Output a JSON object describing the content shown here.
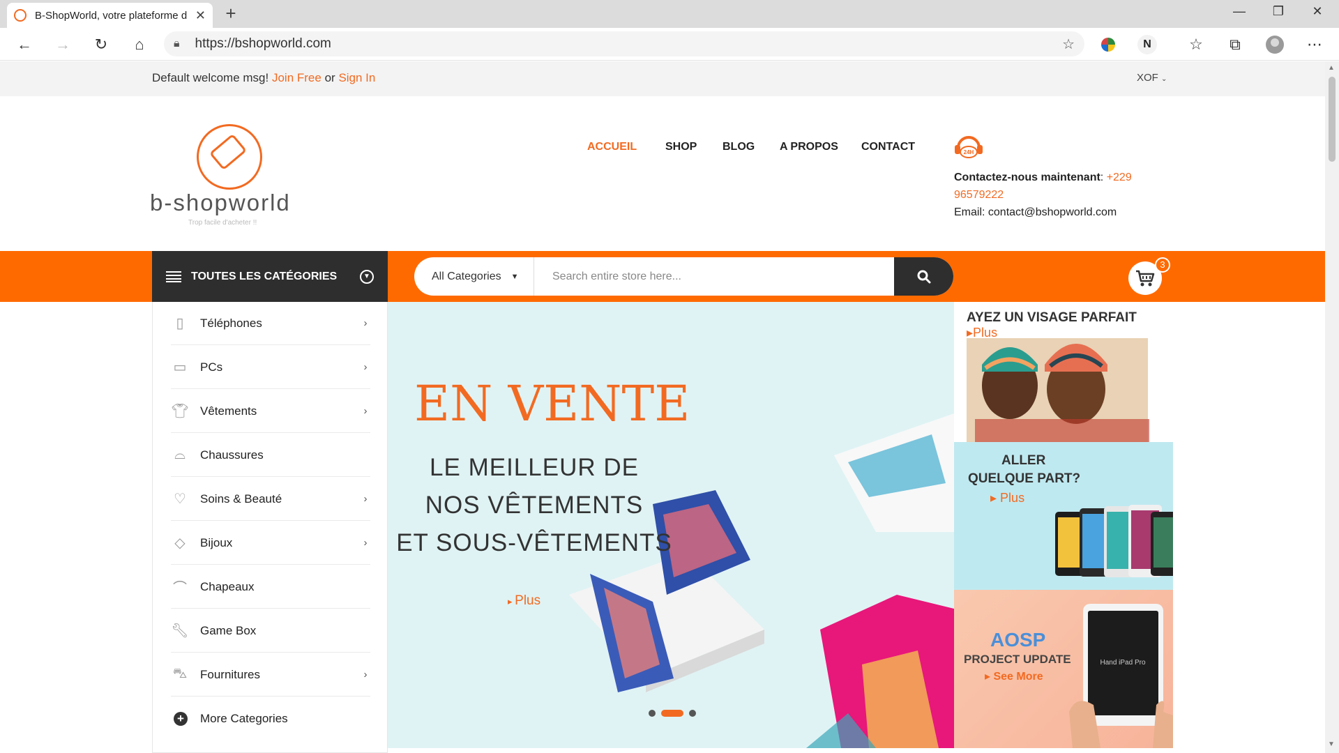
{
  "browser": {
    "tab_title": "B-ShopWorld, votre plateforme d",
    "url": "https://bshopworld.com"
  },
  "topbar": {
    "welcome": "Default welcome msg!",
    "join": "Join Free",
    "or": "or",
    "signin": "Sign In",
    "currency": "XOF"
  },
  "logo": {
    "name": "b-shopworld",
    "tagline": "Trop facile d'acheter !!"
  },
  "nav": [
    "ACCUEIL",
    "SHOP",
    "BLOG",
    "A PROPOS",
    "CONTACT"
  ],
  "support": {
    "badge": "24H",
    "label": "Contactez-nous maintenant",
    "phone": "+229 96579222",
    "email": "Email: contact@bshopworld.com"
  },
  "categories_button": "TOUTES LES CATÉGORIES",
  "search": {
    "category": "All Categories",
    "placeholder": "Search entire store here..."
  },
  "cart": {
    "count": "3"
  },
  "sidebar": {
    "items": [
      {
        "label": "Téléphones",
        "icon": "phone-icon",
        "has_sub": true
      },
      {
        "label": "PCs",
        "icon": "laptop-icon",
        "has_sub": true
      },
      {
        "label": "Vêtements",
        "icon": "shirt-icon",
        "has_sub": true
      },
      {
        "label": "Chaussures",
        "icon": "shoe-icon",
        "has_sub": false
      },
      {
        "label": "Soins & Beauté",
        "icon": "heart-icon",
        "has_sub": true
      },
      {
        "label": "Bijoux",
        "icon": "diamond-icon",
        "has_sub": true
      },
      {
        "label": "Chapeaux",
        "icon": "hat-icon",
        "has_sub": false
      },
      {
        "label": "Game Box",
        "icon": "wrench-icon",
        "has_sub": false
      },
      {
        "label": "Fournitures",
        "icon": "sofa-icon",
        "has_sub": true
      }
    ],
    "more": "More Categories"
  },
  "banner": {
    "title": "EN VENTE",
    "lines": [
      "LE MEILLEUR DE",
      "NOS VÊTEMENTS",
      "ET SOUS-VÊTEMENTS"
    ],
    "more": "Plus"
  },
  "promos": [
    {
      "title": "AYEZ UN VISAGE PARFAIT",
      "more": "Plus"
    },
    {
      "title_1": "ALLER",
      "title_2": "QUELQUE PART?",
      "more": "Plus"
    },
    {
      "title_1": "AOSP",
      "title_2": "PROJECT UPDATE",
      "more": "See More",
      "device": "Hand iPad Pro"
    }
  ],
  "colors": {
    "accent": "#ff6a00",
    "dark": "#2e2e2e"
  }
}
